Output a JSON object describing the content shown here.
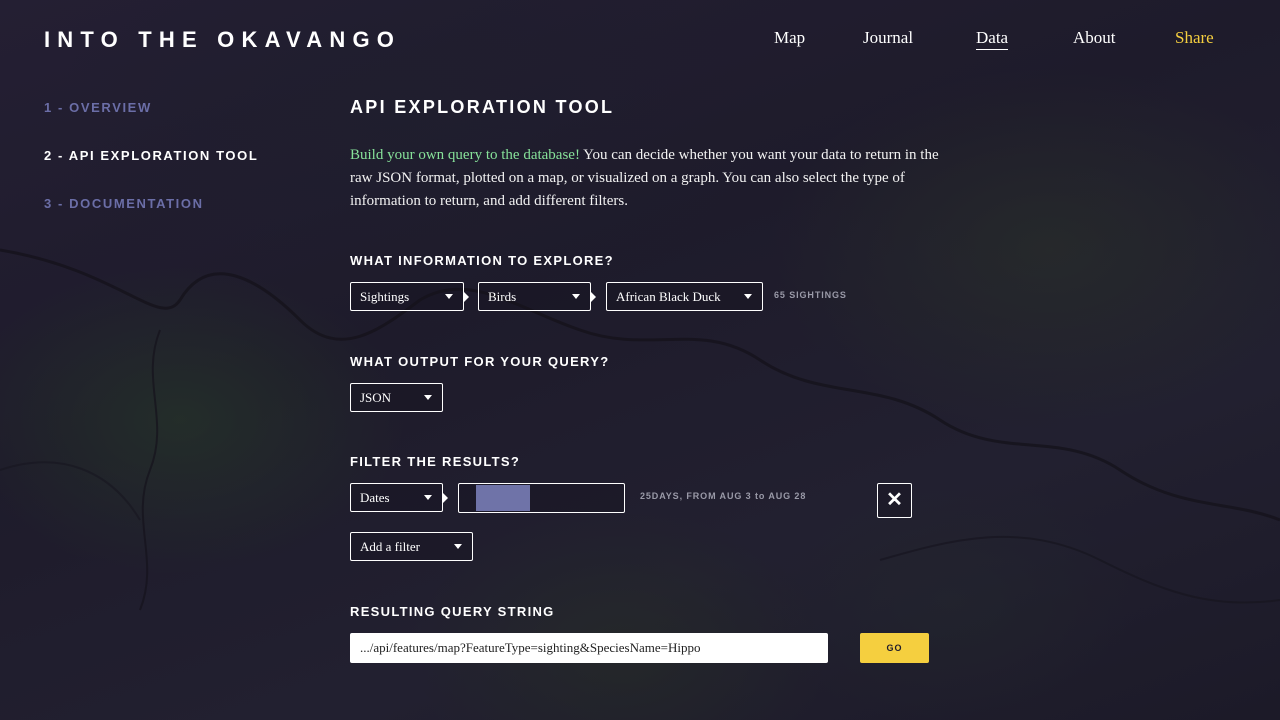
{
  "header": {
    "logo": "INTO THE OKAVANGO",
    "nav": [
      {
        "label": "Map"
      },
      {
        "label": "Journal"
      },
      {
        "label": "Data",
        "active": true
      },
      {
        "label": "About"
      },
      {
        "label": "Share",
        "accent": "#f5cf3f"
      }
    ]
  },
  "sidebar": {
    "items": [
      {
        "label": "1 - OVERVIEW"
      },
      {
        "label": "2 - API EXPLORATION TOOL",
        "active": true
      },
      {
        "label": "3 - DOCUMENTATION"
      }
    ]
  },
  "main": {
    "title": "API EXPLORATION TOOL",
    "intro_highlight": "Build your own query to the database!",
    "intro_rest": " You can decide whether you want your data to return in the raw JSON format, plotted on a map, or visualized on a graph. You can also select the type of information to return, and add different filters.",
    "explore": {
      "heading": "WHAT INFORMATION TO EXPLORE?",
      "type": "Sightings",
      "category": "Birds",
      "species": "African Black Duck",
      "count": "65 SIGHTINGS"
    },
    "output": {
      "heading": "WHAT OUTPUT FOR YOUR QUERY?",
      "format": "JSON"
    },
    "filter": {
      "heading": "FILTER THE RESULTS?",
      "type": "Dates",
      "range_start_fraction": 0.1,
      "range_end_fraction": 0.43,
      "summary_prefix": "25DAYS, FROM AUG 3 ",
      "summary_to": "to",
      "summary_suffix": " AUG 28",
      "add_filter": "Add a filter"
    },
    "query": {
      "heading": "RESULTING QUERY STRING",
      "value": ".../api/features/map?FeatureType=sighting&SpeciesName=Hippo",
      "go": "GO"
    }
  },
  "colors": {
    "background": "#1f1c2c",
    "accent_yellow": "#f5cf3f",
    "highlight_green": "#87e29a",
    "sidebar_inactive": "#6b6ea7",
    "range_fill": "#6f73a8"
  }
}
